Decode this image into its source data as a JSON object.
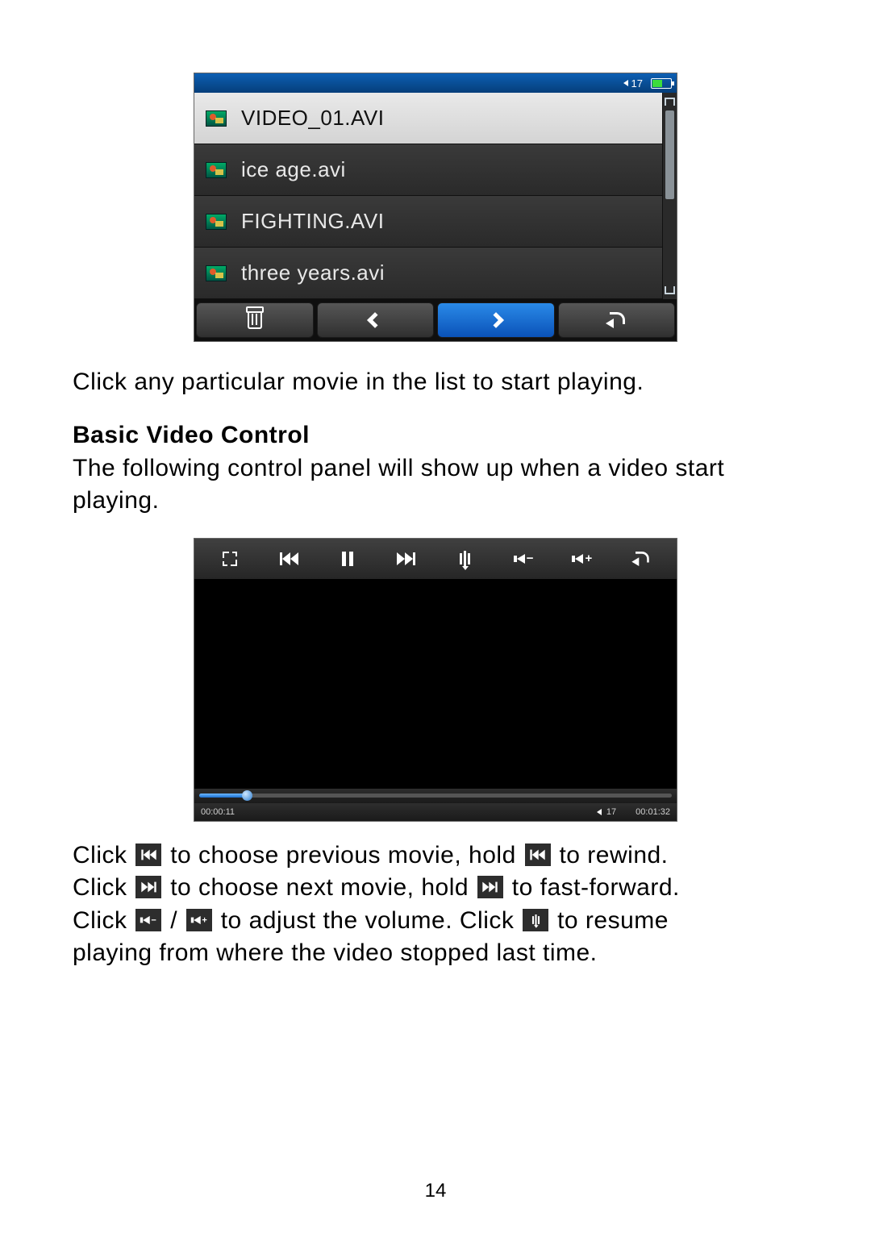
{
  "statusbar": {
    "volume": "17"
  },
  "filelist": {
    "items": [
      {
        "name": "VIDEO_01.AVI",
        "selected": true
      },
      {
        "name": "ice age.avi",
        "selected": false
      },
      {
        "name": "FIGHTING.AVI",
        "selected": false
      },
      {
        "name": "three years.avi",
        "selected": false
      }
    ]
  },
  "text": {
    "intro": "Click any particular movie in the list to start playing.",
    "heading": "Basic Video Control",
    "subhead": "The following control panel will show up when a video start playing."
  },
  "player": {
    "elapsed": "00:00:11",
    "volume": "17",
    "duration": "00:01:32"
  },
  "instructions": {
    "l1a": "Click",
    "l1b": "to choose previous movie, hold",
    "l1c": "to rewind.",
    "l2a": "Click",
    "l2b": "to choose next movie, hold",
    "l2c": "to fast-forward.",
    "l3a": "Click",
    "l3b": "/",
    "l3c": "to adjust the volume. Click",
    "l3d": "to resume",
    "l4": "playing from where the video stopped last time."
  },
  "page": "14"
}
